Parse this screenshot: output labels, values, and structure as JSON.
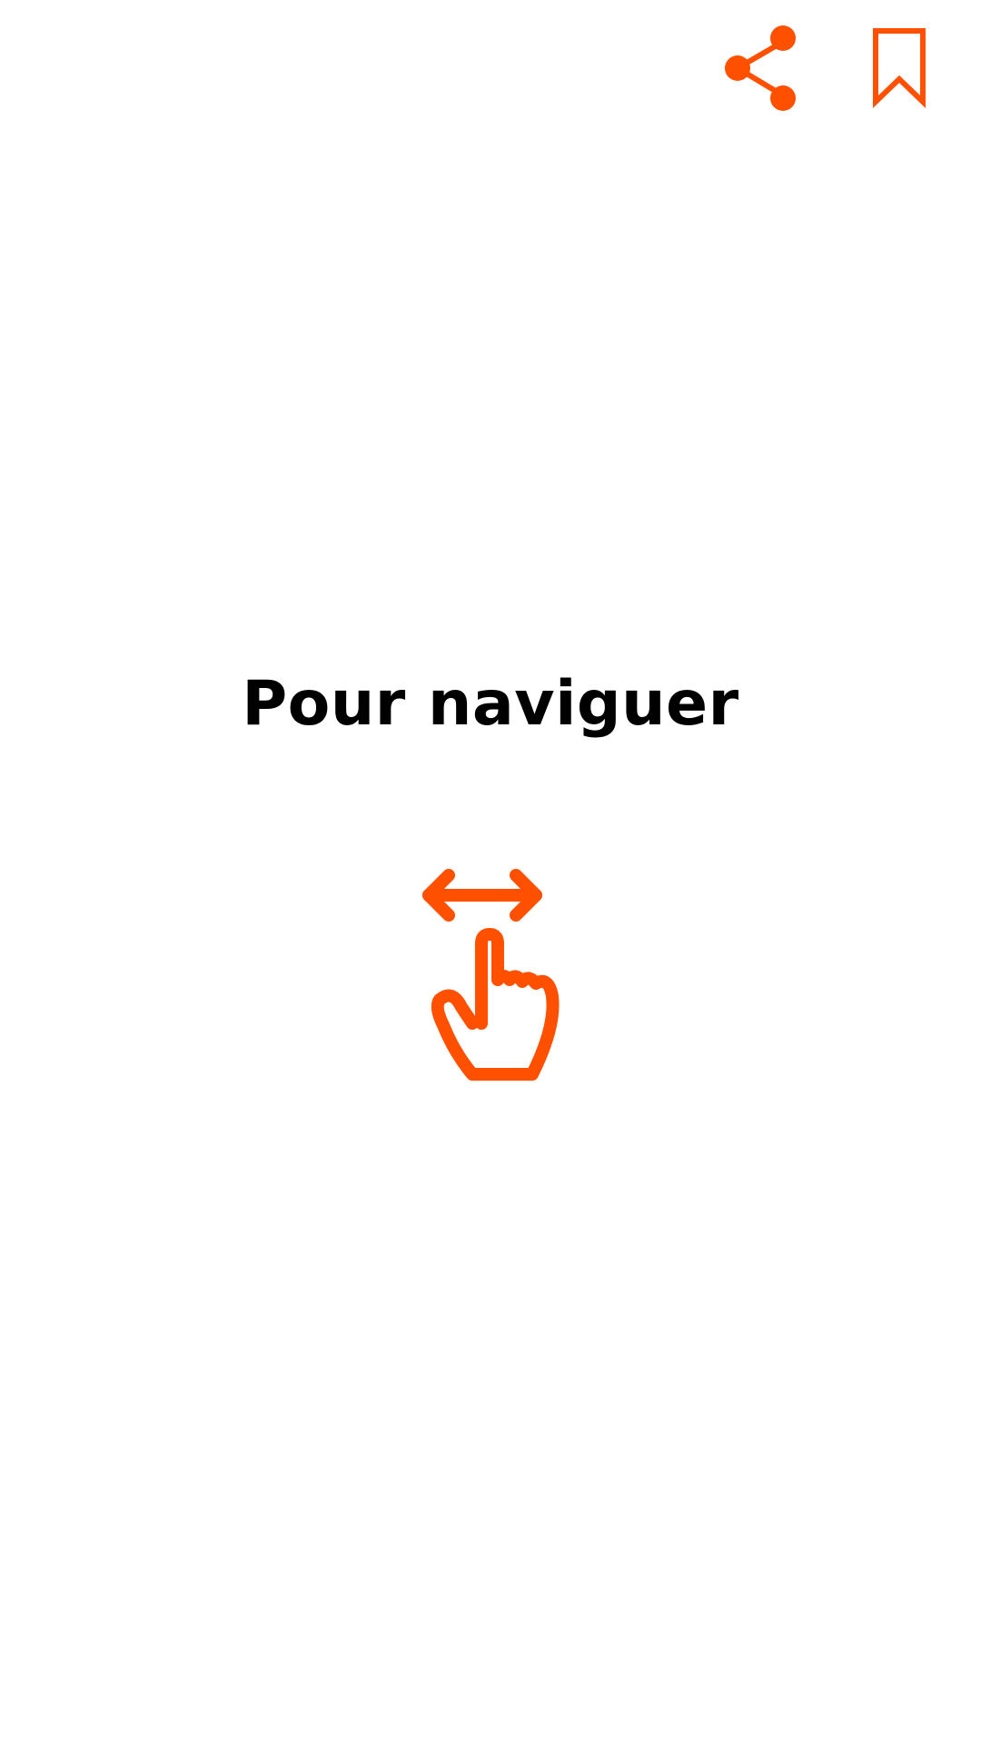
{
  "header": {
    "share_icon": "share-icon",
    "bookmark_icon": "bookmark-icon"
  },
  "main": {
    "title": "Pour naviguer",
    "gesture_icon": "swipe-horizontal-hand-icon"
  },
  "colors": {
    "accent": "#FF5000",
    "text": "#000000",
    "background": "#FFFFFF"
  }
}
